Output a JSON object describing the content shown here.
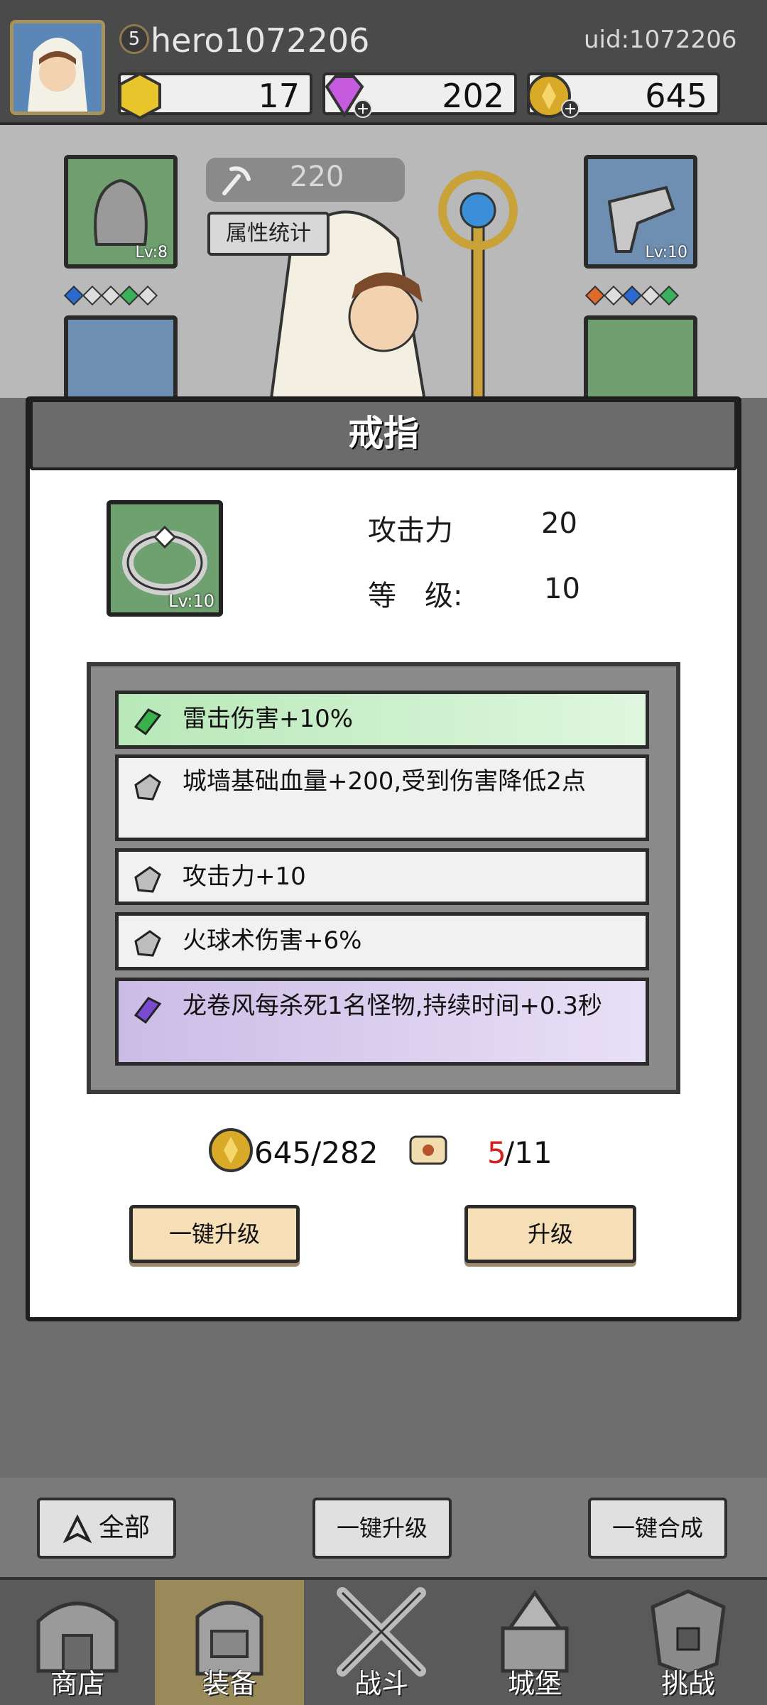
{
  "player": {
    "level": "5",
    "name": "hero1072206",
    "uid_label": "uid:1072206"
  },
  "resources": [
    {
      "name": "gold-hex",
      "value": "17",
      "color": "#e8c52b"
    },
    {
      "name": "gem",
      "value": "202",
      "color": "#c65be0"
    },
    {
      "name": "coin",
      "value": "645",
      "color": "#d9a928"
    }
  ],
  "hero": {
    "pickaxe_value": "220",
    "stats_button": "属性统计",
    "slots": [
      {
        "name": "helmet",
        "level": "Lv:8",
        "color": "green"
      },
      {
        "name": "gloves",
        "level": "Lv:10",
        "color": "blue"
      },
      {
        "name": "armor",
        "level": "",
        "color": "blue"
      },
      {
        "name": "ring",
        "level": "",
        "color": "green"
      }
    ]
  },
  "modal": {
    "title": "戒指",
    "item_level_badge": "Lv:10",
    "attack_label": "攻击力",
    "attack_value": "20",
    "level_label": "等　级:",
    "level_value": "10",
    "affixes": [
      {
        "text": "雷击伤害+10%",
        "rarity": "green"
      },
      {
        "text": "城墙基础血量+200,受到伤害降低2点",
        "rarity": "gray"
      },
      {
        "text": "攻击力+10",
        "rarity": "gray"
      },
      {
        "text": "火球术伤害+6%",
        "rarity": "gray"
      },
      {
        "text": "龙卷风每杀死1名怪物,持续时间+0.3秒",
        "rarity": "purple"
      }
    ],
    "gold_cost": "645/282",
    "scroll_current": "5",
    "scroll_required": "/11",
    "btn_one_key_upgrade": "一键升级",
    "btn_upgrade": "升级"
  },
  "bottom_buttons": {
    "all": "全部",
    "one_key_upgrade": "一键升级",
    "one_key_merge": "一键合成"
  },
  "tabs": [
    {
      "label": "商店",
      "icon": "shop-icon"
    },
    {
      "label": "装备",
      "icon": "backpack-icon",
      "active": true
    },
    {
      "label": "战斗",
      "icon": "swords-icon"
    },
    {
      "label": "城堡",
      "icon": "castle-icon"
    },
    {
      "label": "挑战",
      "icon": "challenge-icon"
    }
  ]
}
